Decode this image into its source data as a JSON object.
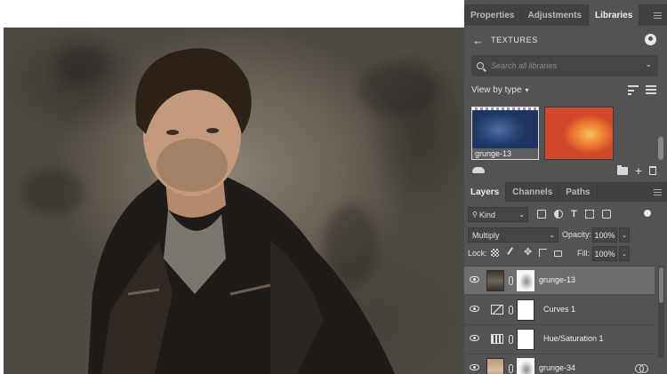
{
  "panel_tabs": [
    {
      "label": "Properties",
      "active": false
    },
    {
      "label": "Adjustments",
      "active": false
    },
    {
      "label": "Libraries",
      "active": true
    }
  ],
  "libraries": {
    "library_name": "TEXTURES",
    "search_placeholder": "Search all libraries",
    "view_by": "View by type",
    "thumbnails": [
      {
        "label": "grunge-13",
        "color": "#2c4a7c"
      },
      {
        "label": "",
        "color": "#ef7d34"
      }
    ]
  },
  "layers_tabs": [
    {
      "label": "Layers",
      "active": true
    },
    {
      "label": "Channels",
      "active": false
    },
    {
      "label": "Paths",
      "active": false
    }
  ],
  "layers_controls": {
    "kind_filter": "Kind",
    "blend_mode": "Multiply",
    "opacity_label": "Opacity:",
    "opacity_value": "100%",
    "lock_label": "Lock:",
    "fill_label": "Fill:",
    "fill_value": "100%"
  },
  "layers": [
    {
      "name": "grunge-13",
      "kind": "texture",
      "selected": true
    },
    {
      "name": "Curves 1",
      "kind": "curves-adjustment",
      "selected": false
    },
    {
      "name": "Hue/Saturation 1",
      "kind": "hue-saturation-adjustment",
      "selected": false
    },
    {
      "name": "grunge-34",
      "kind": "texture",
      "selected": false
    }
  ],
  "icons": {
    "back": "arrow-left-icon",
    "user": "user-icon",
    "search": "search-icon",
    "cloud": "cloud-icon",
    "folder": "folder-icon",
    "add": "plus-icon",
    "delete": "trash-icon",
    "visibility": "eye-icon"
  },
  "colors": {
    "panel_bg": "#535353",
    "tabbar_bg": "#424242",
    "selected_row": "#6e6e6e"
  }
}
